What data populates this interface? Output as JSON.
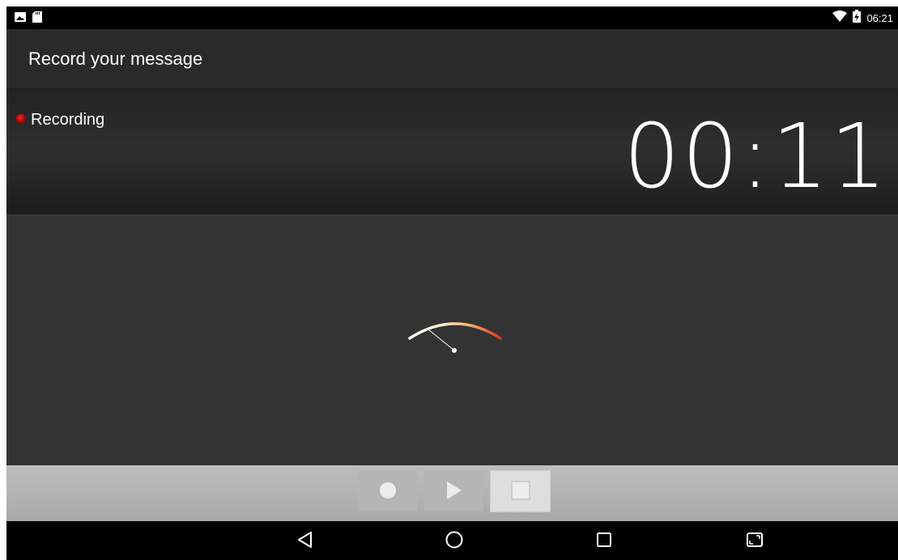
{
  "status_bar": {
    "time": "06:21",
    "icons": [
      "gallery-icon",
      "sd-card-icon",
      "wifi-icon",
      "battery-charging-icon"
    ]
  },
  "app_bar": {
    "title": "Record your message"
  },
  "recorder": {
    "state_label": "Recording",
    "elapsed_time": "00:11"
  },
  "controls": {
    "buttons": [
      "record-icon",
      "play-icon",
      "stop-icon"
    ]
  },
  "nav_bar": {
    "buttons": [
      "back-icon",
      "home-icon",
      "recents-icon",
      "screenshot-icon"
    ]
  },
  "colors": {
    "recording_dot": "#b00000",
    "meter_gradient": [
      "#ffffff",
      "#f4a85c",
      "#e0301a"
    ],
    "background": "#333333"
  }
}
